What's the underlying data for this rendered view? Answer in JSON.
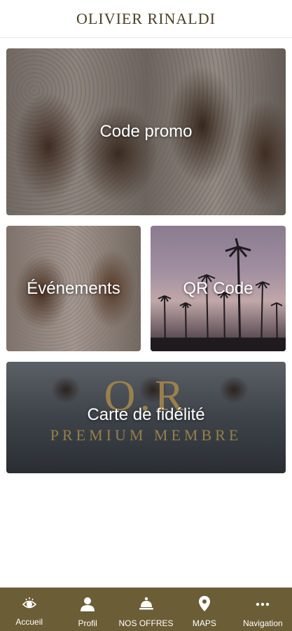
{
  "header": {
    "title": "OLIVIER RINALDI"
  },
  "tiles": {
    "promo": {
      "label": "Code promo"
    },
    "events": {
      "label": "Événements"
    },
    "qr": {
      "label": "QR Code"
    },
    "card": {
      "label": "Carte de fidélité",
      "logo_text": "O.R",
      "logo_subtext": "PREMIUM MEMBRE"
    }
  },
  "nav": {
    "items": [
      {
        "label": "Accueil",
        "icon": "eye-icon"
      },
      {
        "label": "Profil",
        "icon": "user-icon"
      },
      {
        "label": "NOS OFFRES",
        "icon": "service-bell-icon"
      },
      {
        "label": "MAPS",
        "icon": "map-pin-icon"
      },
      {
        "label": "Navigation",
        "icon": "more-dots-icon"
      }
    ]
  },
  "colors": {
    "nav_background": "#6b5d35",
    "brand_gold": "#a88a4a",
    "title": "#4a3f24"
  }
}
